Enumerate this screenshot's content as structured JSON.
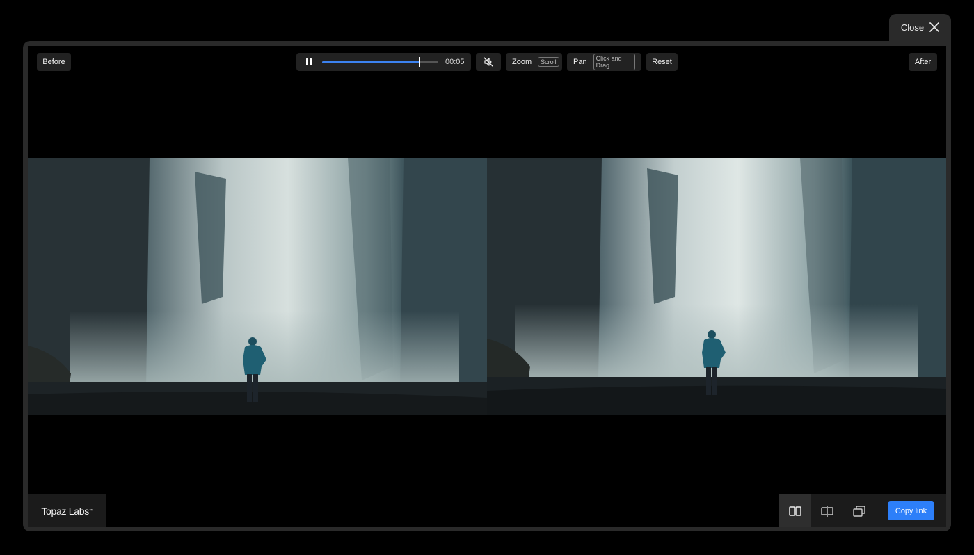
{
  "window": {
    "close_label": "Close"
  },
  "toolbar": {
    "before_label": "Before",
    "after_label": "After",
    "time": "00:05",
    "progress": 0.84,
    "zoom_label": "Zoom",
    "zoom_hint": "Scroll",
    "pan_label": "Pan",
    "pan_hint": "Click and Drag",
    "reset_label": "Reset"
  },
  "brand": {
    "name": "Topaz Labs",
    "trademark": "™"
  },
  "bottom": {
    "view_modes": [
      "side-by-side-icon",
      "split-slider-icon",
      "overlay-icon"
    ],
    "copy_link_label": "Copy link"
  },
  "colors": {
    "accent": "#2d7ff9",
    "progress": "#3c82f0"
  }
}
